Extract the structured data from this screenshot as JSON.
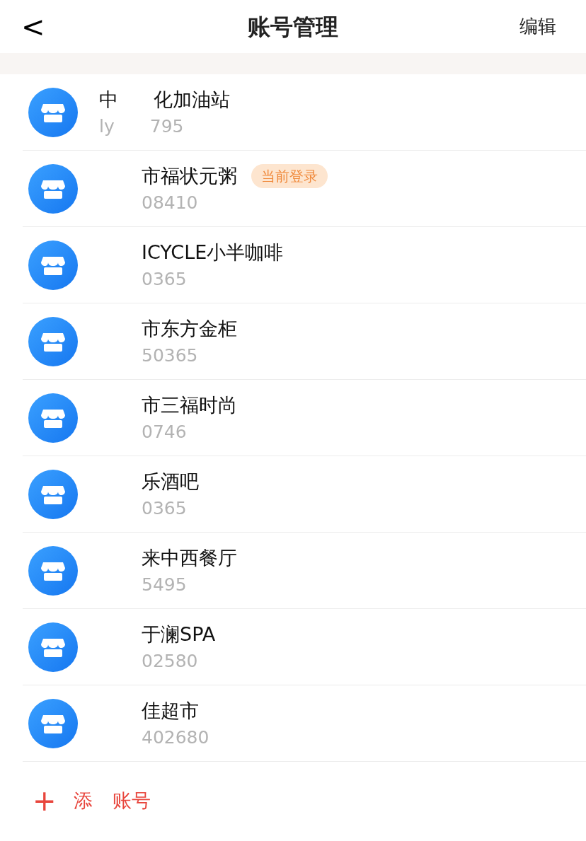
{
  "header": {
    "back": "<",
    "title": "账号管理",
    "action": "编辑"
  },
  "accounts": [
    {
      "name": [
        "中",
        "化加油站"
      ],
      "account": [
        "ly",
        "795"
      ],
      "current": false
    },
    {
      "name": [
        "市福状元粥"
      ],
      "account": [
        "08410"
      ],
      "current": true,
      "badge": "当前登录"
    },
    {
      "name": [
        "ICYCLE小半咖啡"
      ],
      "account": [
        "0365"
      ],
      "current": false
    },
    {
      "name": [
        "市东方金柜"
      ],
      "account": [
        "50365"
      ],
      "current": false
    },
    {
      "name": [
        "市三福时尚"
      ],
      "account": [
        "0746"
      ],
      "current": false
    },
    {
      "name": [
        "乐酒吧"
      ],
      "account": [
        "0365"
      ],
      "current": false
    },
    {
      "name": [
        "来中西餐厅"
      ],
      "account": [
        "5495"
      ],
      "current": false
    },
    {
      "name": [
        "于澜SPA"
      ],
      "account": [
        "02580"
      ],
      "current": false
    },
    {
      "name": [
        "佳超市"
      ],
      "account": [
        "402680"
      ],
      "current": false
    }
  ],
  "add": {
    "icon": "+",
    "label": [
      "添",
      "账号"
    ]
  }
}
